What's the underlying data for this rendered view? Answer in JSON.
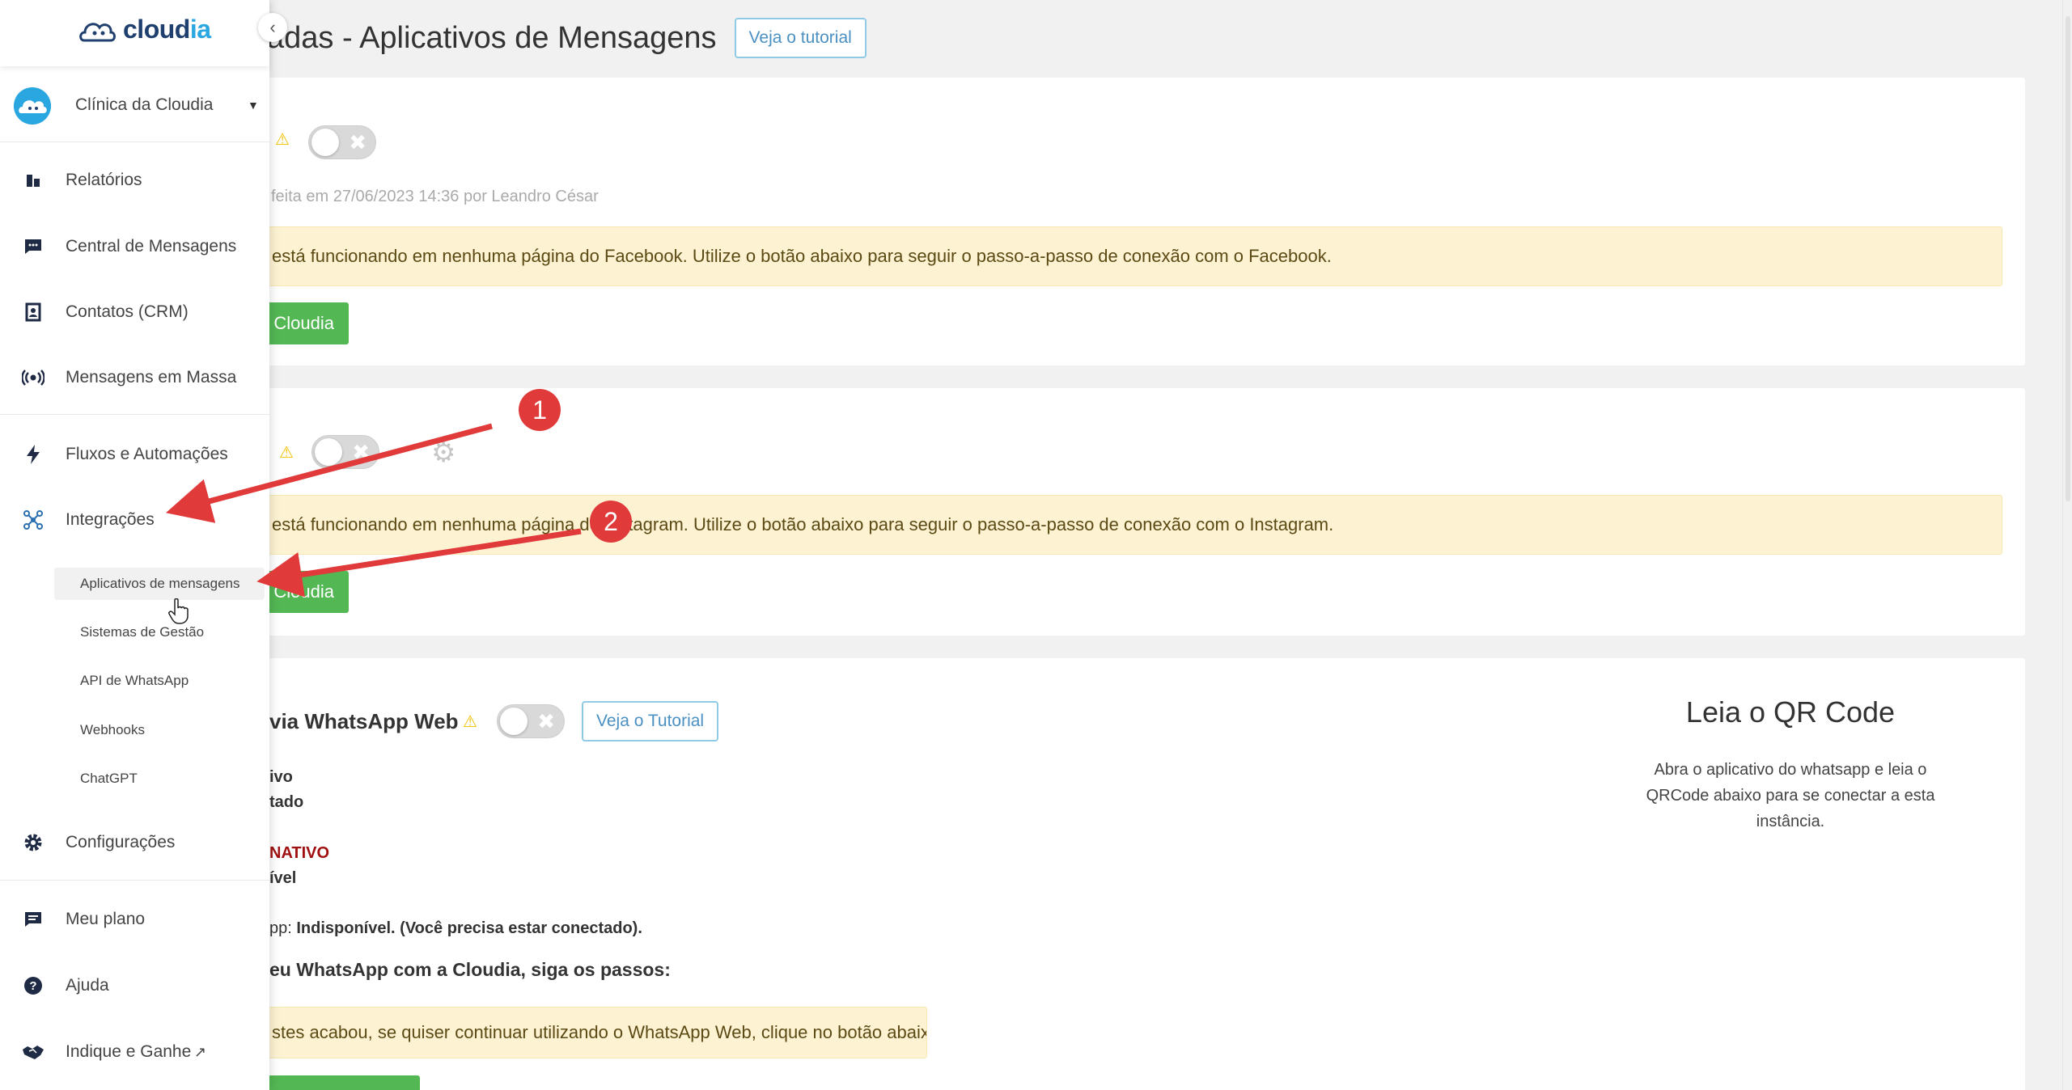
{
  "page": {
    "title": "adas - Aplicativos de Mensagens",
    "tutorial_button": "Veja o tutorial"
  },
  "facebook_card": {
    "meta": "feita em 27/06/2023 14:36 por Leandro César",
    "alert": "está funcionando em nenhuma página do Facebook. Utilize o botão abaixo para seguir o passo-a-passo de conexão com o Facebook.",
    "button": "Cloudia"
  },
  "instagram_card": {
    "alert": "está funcionando em nenhuma página do Instagram. Utilize o botão abaixo para seguir o passo-a-passo de conexão com o Instagram.",
    "button": "Cloudia"
  },
  "whatsapp_card": {
    "title": "via WhatsApp Web",
    "tutorial_button": "Veja o Tutorial",
    "line1": "ivo",
    "line2": "tado",
    "line3": "NATIVO",
    "line4": "ível",
    "line5_prefix": "pp: ",
    "line5_value": "Indisponível. (Você precisa estar conectado).",
    "steps_title": "eu WhatsApp com a Cloudia, siga os passos:",
    "alert": "stes acabou, se quiser continuar utilizando o WhatsApp Web, clique no botão abaixo."
  },
  "qr": {
    "title": "Leia o QR Code",
    "description": "Abra o aplicativo do whatsapp e leia o QRCode abaixo para se conectar a esta instância."
  },
  "sidebar": {
    "logo_main": "cloud",
    "logo_accent": "ia",
    "clinic_name": "Clínica da Cloudia",
    "items": [
      {
        "label": "Relatórios",
        "icon": "bar-chart-icon"
      },
      {
        "label": "Central de Mensagens",
        "icon": "chat-icon"
      },
      {
        "label": "Contatos (CRM)",
        "icon": "contact-card-icon"
      },
      {
        "label": "Mensagens em Massa",
        "icon": "broadcast-icon"
      },
      {
        "label": "Fluxos e Automações",
        "icon": "lightning-icon"
      },
      {
        "label": "Integrações",
        "icon": "integrations-icon"
      },
      {
        "label": "Configurações",
        "icon": "gear-icon"
      },
      {
        "label": "Meu plano",
        "icon": "plan-icon"
      },
      {
        "label": "Ajuda",
        "icon": "help-icon"
      },
      {
        "label": "Indique e Ganhe",
        "icon": "handshake-icon"
      }
    ],
    "sub_items": [
      {
        "label": "Aplicativos de mensagens"
      },
      {
        "label": "Sistemas de Gestão"
      },
      {
        "label": "API de WhatsApp"
      },
      {
        "label": "Webhooks"
      },
      {
        "label": "ChatGPT"
      }
    ]
  },
  "annotations": {
    "badge1": "1",
    "badge2": "2"
  },
  "colors": {
    "accent": "#2aa6e0",
    "brand_dark": "#1f3f6e",
    "green": "#53b753",
    "alert_bg": "#fdf3d3",
    "annotation_red": "#e03a3a"
  }
}
